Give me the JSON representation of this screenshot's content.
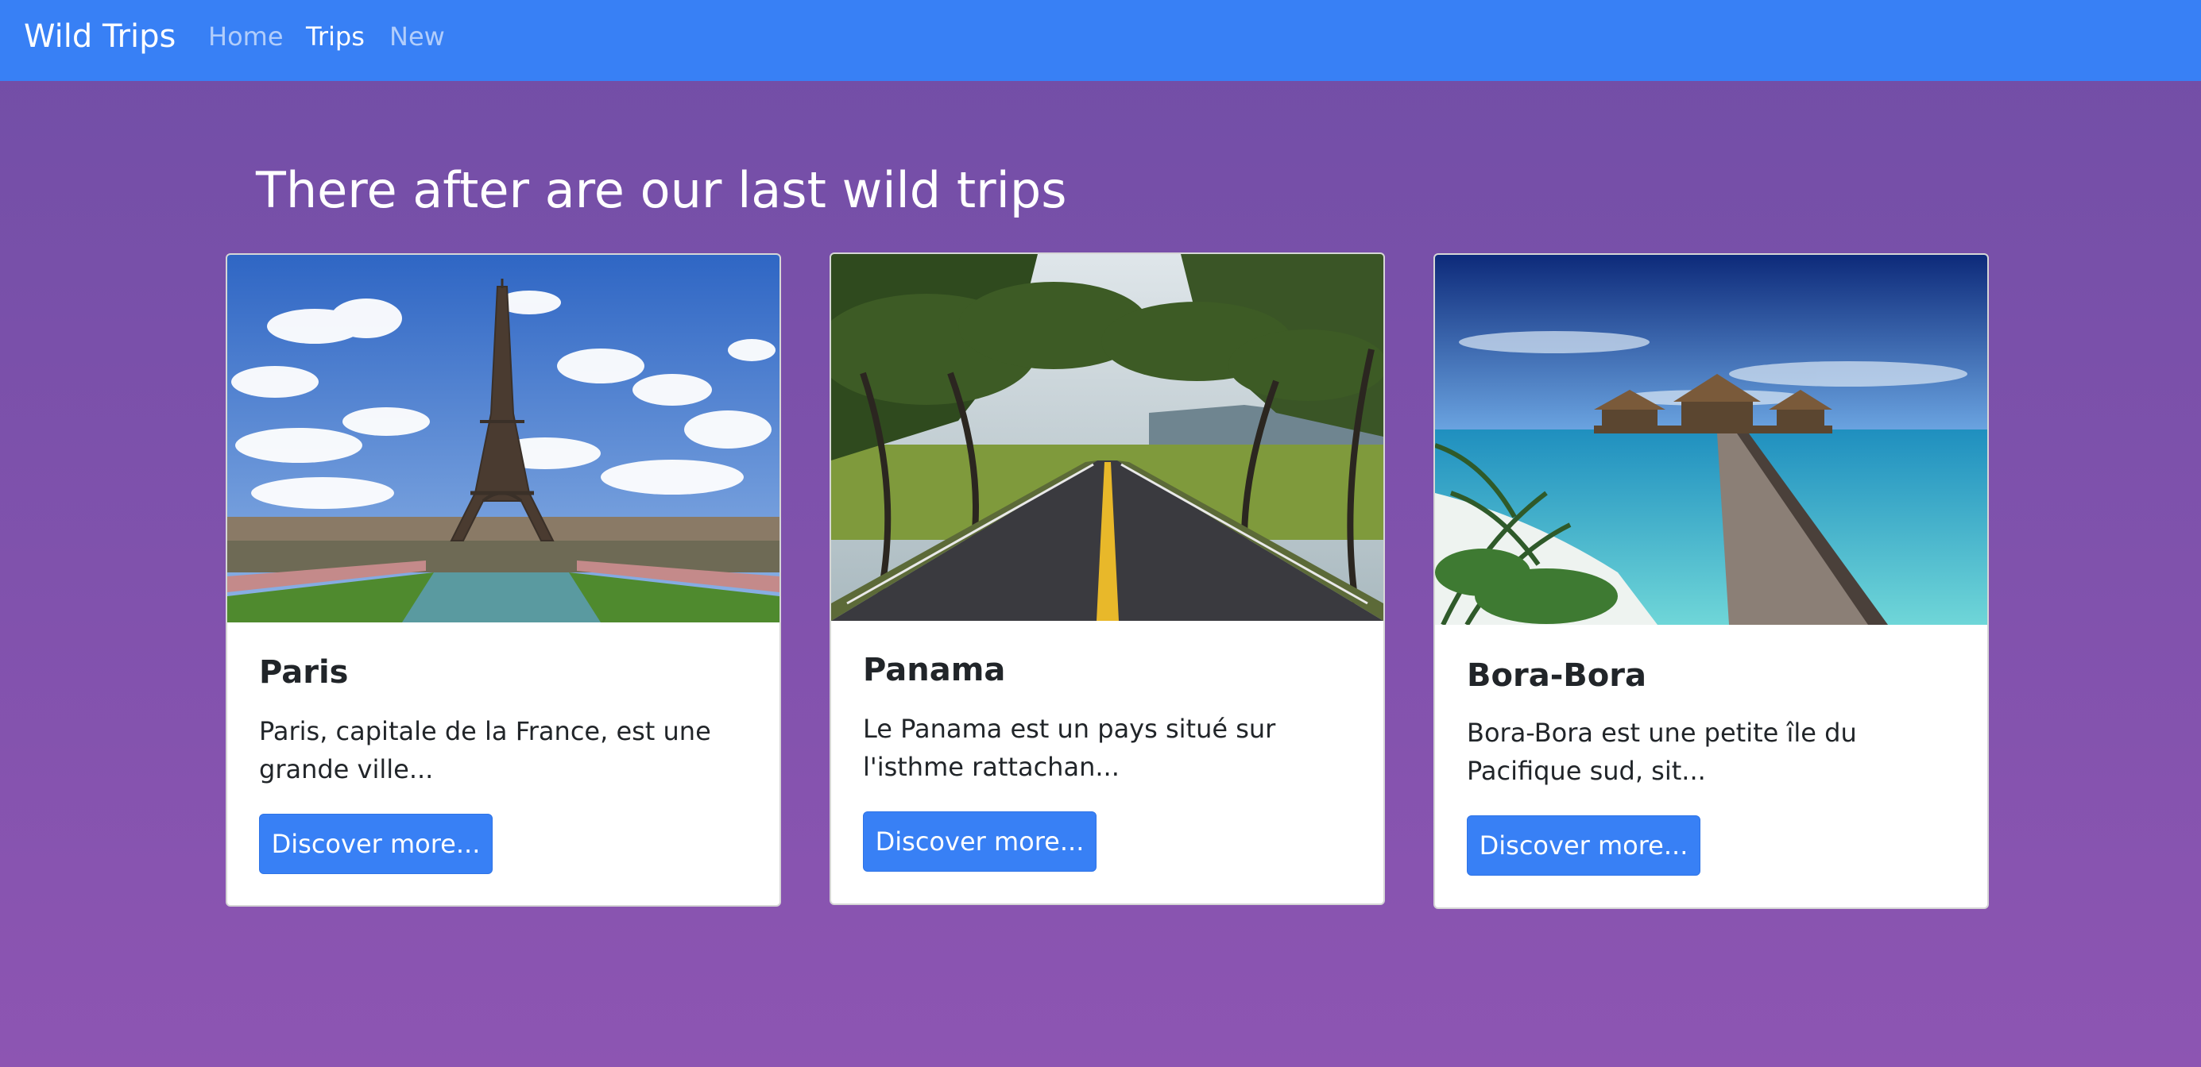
{
  "navbar": {
    "brand": "Wild Trips",
    "links": [
      {
        "label": "Home",
        "active": false
      },
      {
        "label": "Trips",
        "active": true
      },
      {
        "label": "New",
        "active": false
      }
    ],
    "background": "#3880f5"
  },
  "main": {
    "heading": "There after are our last wild trips",
    "background_top": "#714ea6",
    "background_bottom": "#8d55b2"
  },
  "trips": [
    {
      "title": "Paris",
      "text": "Paris, capitale de la France, est une grande ville...",
      "button": "Discover more...",
      "image": "eiffel-tower-photo"
    },
    {
      "title": "Panama",
      "text": "Le Panama est un pays situé sur l'isthme rattachan...",
      "button": "Discover more...",
      "image": "tree-lined-road-photo"
    },
    {
      "title": "Bora-Bora",
      "text": "Bora-Bora est une petite île du Pacifique sud, sit...",
      "button": "Discover more...",
      "image": "overwater-bungalows-photo"
    }
  ]
}
